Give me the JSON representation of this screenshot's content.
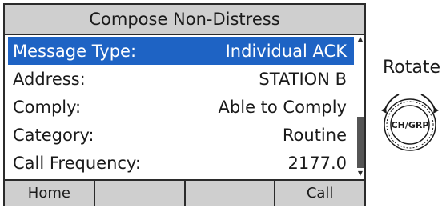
{
  "screen": {
    "title": "Compose Non-Distress",
    "rows": [
      {
        "label": "Message Type:",
        "value": "Individual ACK"
      },
      {
        "label": "Address:",
        "value": "STATION B"
      },
      {
        "label": "Comply:",
        "value": "Able to Comply"
      },
      {
        "label": "Category:",
        "value": "Routine"
      },
      {
        "label": "Call Frequency:",
        "value": "2177.0"
      }
    ],
    "selected_row": "Message Type:",
    "softkeys": [
      "Home",
      "",
      "",
      "Call"
    ]
  },
  "knob": {
    "label": "Rotate",
    "button_text": "CH/GRP"
  },
  "colors": {
    "selection": "#1e63c4",
    "bar_background": "#cfcfcf"
  }
}
